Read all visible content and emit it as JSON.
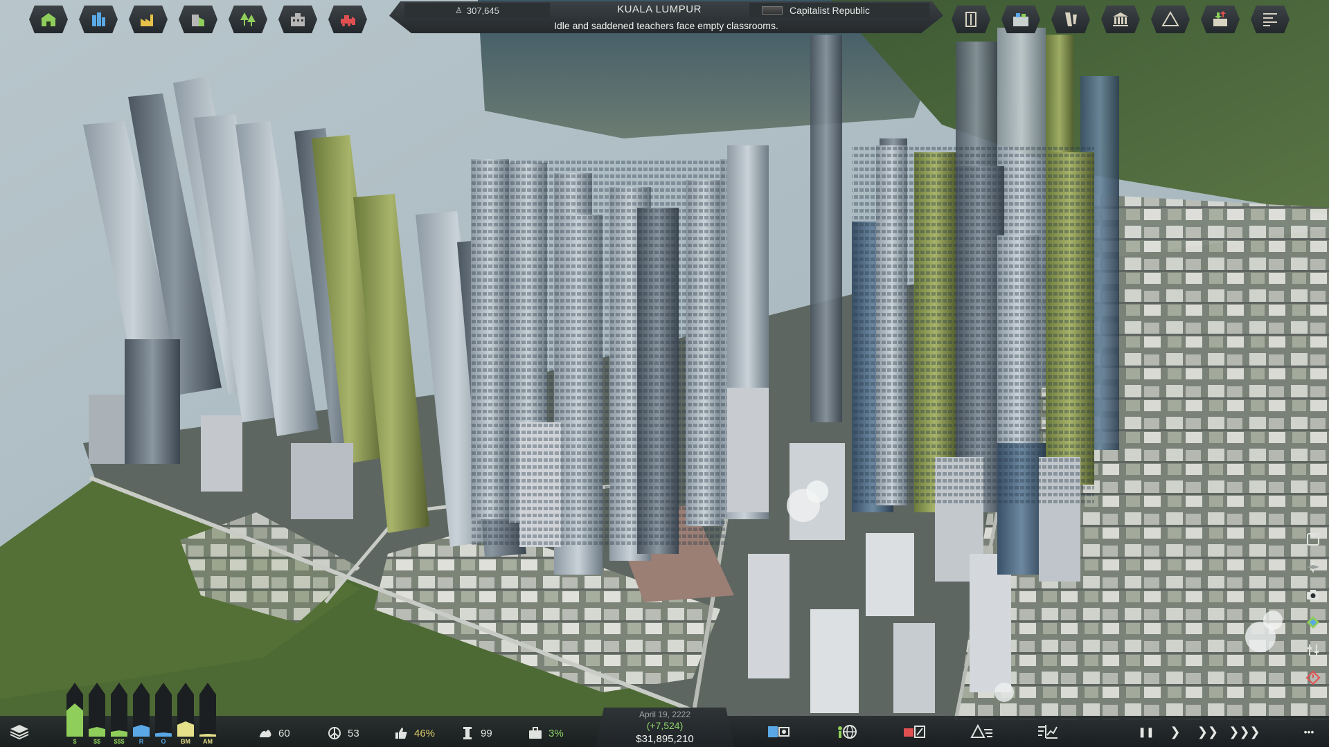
{
  "top_bar": {
    "left_tools": [
      {
        "name": "residential-zone-icon",
        "color": "#8fce5a"
      },
      {
        "name": "commercial-zone-icon",
        "color": "#5aa9e6"
      },
      {
        "name": "industrial-zone-icon",
        "color": "#e6c24a"
      },
      {
        "name": "office-zone-icon",
        "color": "#b6b6b6"
      },
      {
        "name": "parks-icon",
        "color": "#8fce5a"
      },
      {
        "name": "services-icon",
        "color": "#b6b6b6"
      },
      {
        "name": "bulldoze-icon",
        "color": "#e05050"
      }
    ],
    "population": "307,645",
    "city_name": "KUALA LUMPUR",
    "government": "Capitalist Republic",
    "headline": "Idle and saddened teachers face empty classrooms.",
    "right_tools": [
      {
        "name": "edicts-icon",
        "color": "#d8d2c0"
      },
      {
        "name": "districts-icon",
        "color": "#c8d0d0"
      },
      {
        "name": "research-icon",
        "color": "#d8d2c0"
      },
      {
        "name": "government-icon",
        "color": "#d8d2c0"
      },
      {
        "name": "terrain-icon",
        "color": "#d8d2c0"
      },
      {
        "name": "trade-icon",
        "color": "#d8d2c0"
      },
      {
        "name": "almanac-icon",
        "color": "#d8d2c0"
      }
    ]
  },
  "right_toolbar": [
    {
      "name": "save-icon"
    },
    {
      "name": "compass-icon"
    },
    {
      "name": "camera-icon"
    },
    {
      "name": "map-icon"
    },
    {
      "name": "settings-sliders-icon"
    },
    {
      "name": "power-icon"
    }
  ],
  "bottom_bar": {
    "demand": [
      {
        "label": "$",
        "level": 0.62,
        "color": "#8fce5a"
      },
      {
        "label": "$$",
        "level": 0.18,
        "color": "#8fce5a"
      },
      {
        "label": "$$$",
        "level": 0.12,
        "color": "#8fce5a"
      },
      {
        "label": "R",
        "level": 0.22,
        "color": "#5aa9e6"
      },
      {
        "label": "O",
        "level": 0.08,
        "color": "#5aa9e6"
      },
      {
        "label": "BM",
        "level": 0.28,
        "color": "#e6e08a"
      },
      {
        "label": "AM",
        "level": 0.05,
        "color": "#e6e08a"
      }
    ],
    "stats": {
      "pollution": "60",
      "peace": "53",
      "approval": "46%",
      "vehicles": "99",
      "unemployment": "3%"
    },
    "date": "April 19, 2222",
    "income": "(+7,524)",
    "balance": "$31,895,210",
    "tools": [
      {
        "name": "budget-icon"
      },
      {
        "name": "world-icon"
      },
      {
        "name": "emergency-icon"
      },
      {
        "name": "infoviews-icon"
      },
      {
        "name": "statistics-icon"
      }
    ],
    "speed_controls": [
      {
        "name": "pause-button",
        "glyph": "❚❚"
      },
      {
        "name": "play-button",
        "glyph": "❯"
      },
      {
        "name": "fast-forward-button",
        "glyph": "❯❯"
      },
      {
        "name": "fastest-button",
        "glyph": "❯❯❯"
      }
    ],
    "more_glyph": "•••"
  }
}
